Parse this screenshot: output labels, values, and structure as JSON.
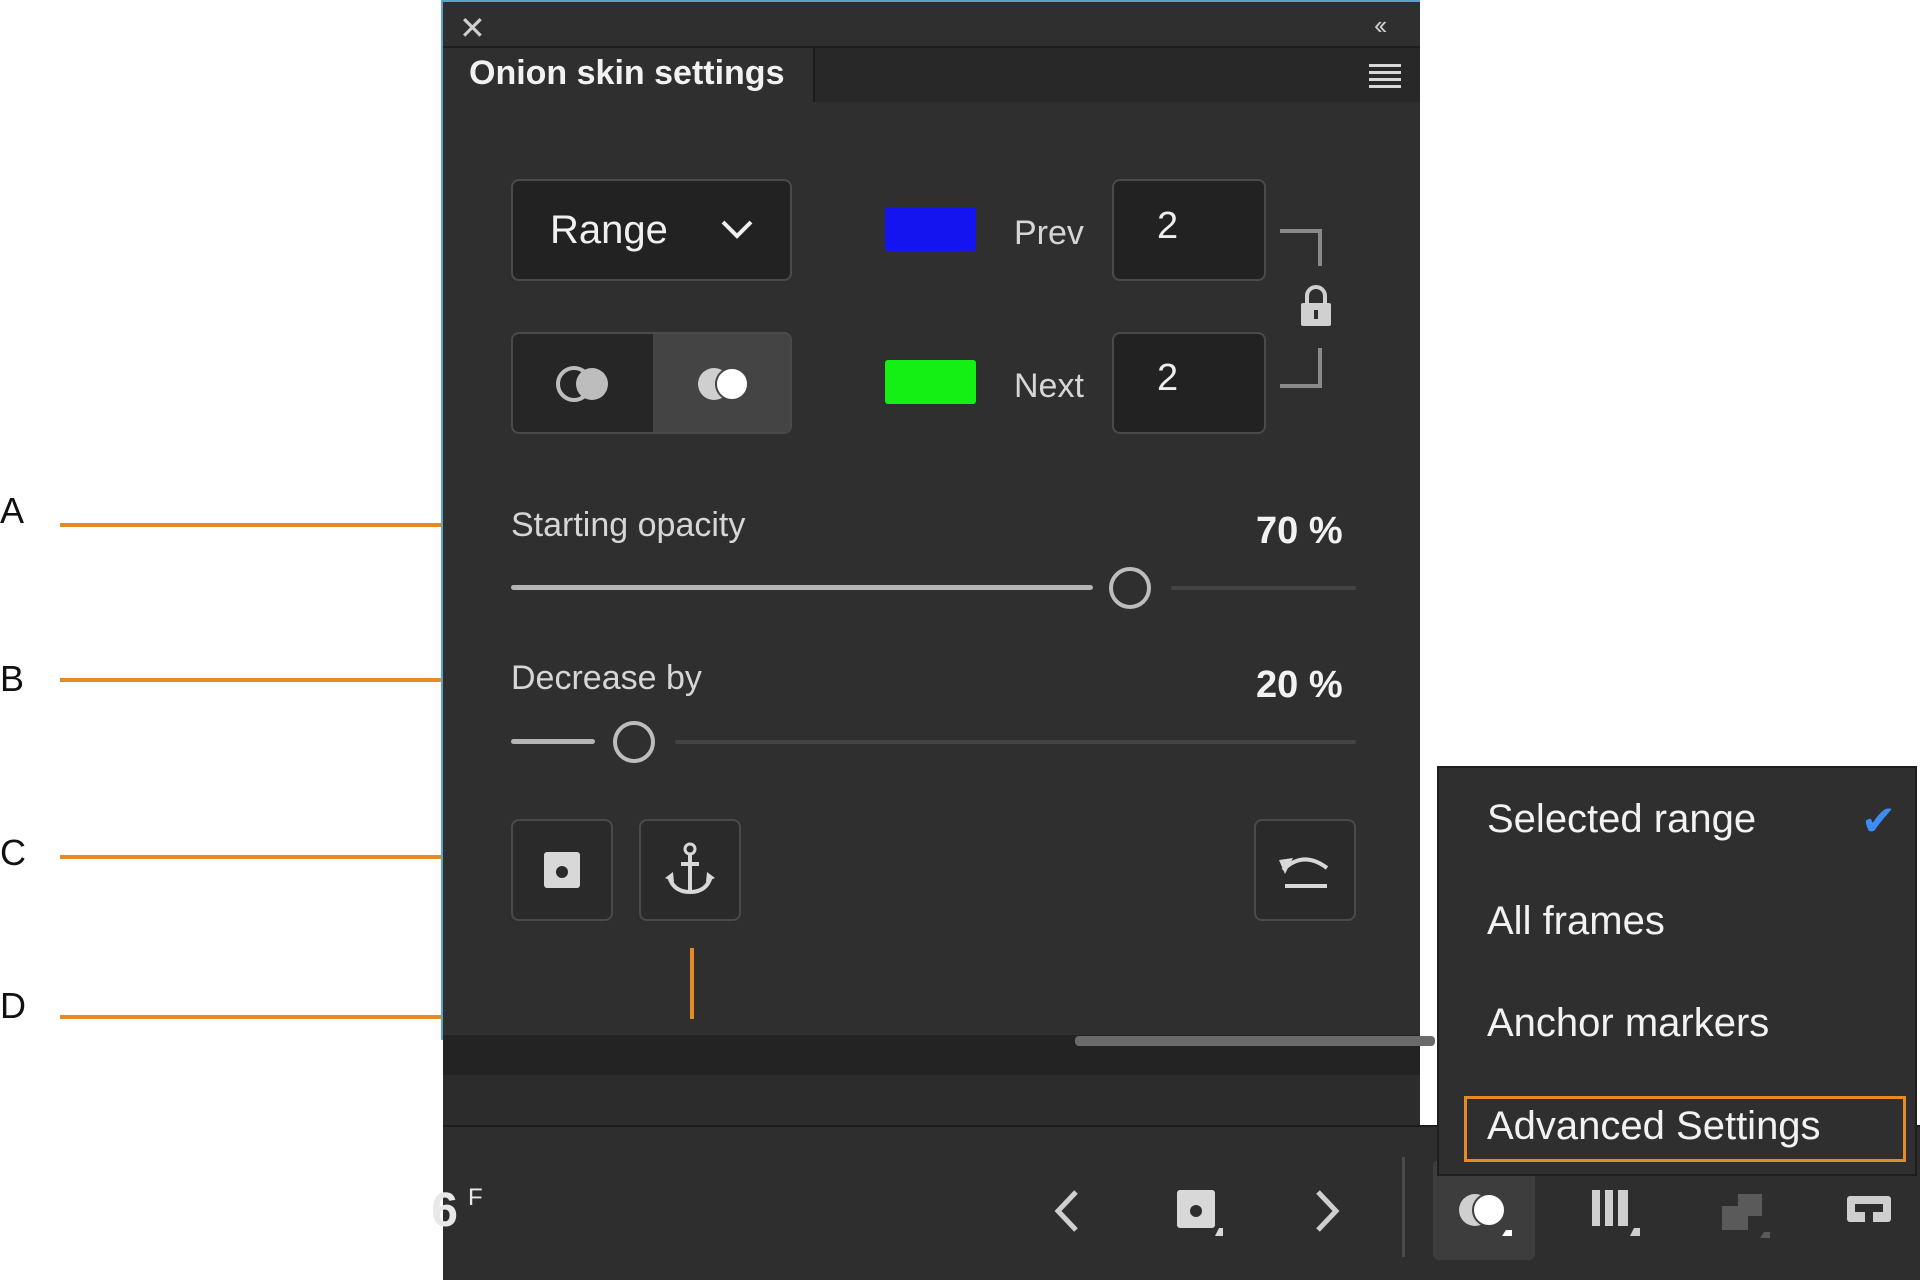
{
  "callouts": [
    "A",
    "B",
    "C",
    "D"
  ],
  "panel": {
    "title": "Onion skin settings",
    "close_glyph": "✕",
    "collapse_glyph": "‹‹",
    "mode_dropdown": {
      "selected": "Range"
    },
    "prev": {
      "label": "Prev",
      "value": "2",
      "color": "#1414f0"
    },
    "next": {
      "label": "Next",
      "value": "2",
      "color": "#14f014"
    },
    "starting_opacity": {
      "label": "Starting opacity",
      "value_text": "70 %",
      "value": 70
    },
    "decrease_by": {
      "label": "Decrease by",
      "value_text": "20 %",
      "value": 20
    }
  },
  "timeline": {
    "frame_number": "6",
    "frame_unit": "F",
    "prev_glyph": "‹",
    "next_glyph": "›"
  },
  "popup_menu": {
    "items": [
      {
        "label": "Selected range",
        "checked": true
      },
      {
        "label": "All frames",
        "checked": false
      },
      {
        "label": "Anchor markers",
        "checked": false
      },
      {
        "label": "Advanced Settings",
        "checked": false,
        "highlighted": true
      }
    ],
    "check_glyph": "✔"
  }
}
